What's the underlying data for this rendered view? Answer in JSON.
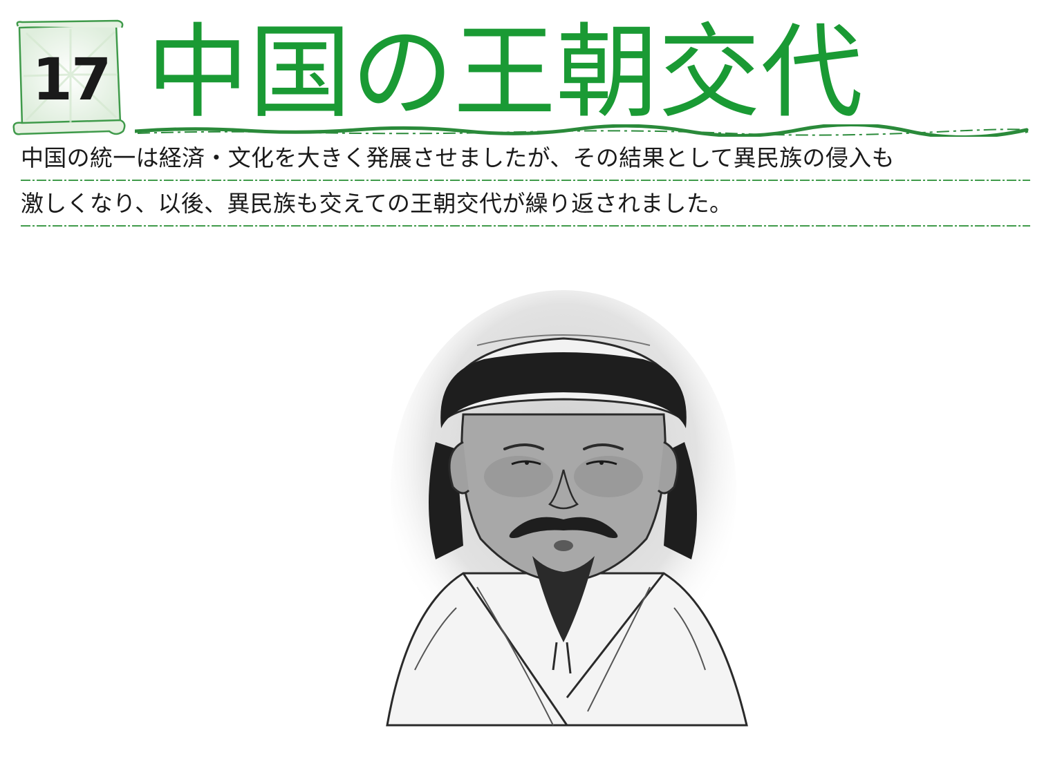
{
  "chapter": {
    "number": "17",
    "title": "中国の王朝交代"
  },
  "intro": {
    "line1": "中国の統一は経済・文化を大きく発展させましたが、その結果として異民族の侵入も",
    "line2": "激しくなり、以後、異民族も交えての王朝交代が繰り返されました。"
  },
  "colors": {
    "accent": "#1a9a34",
    "scroll_fill": "#f2f8ee",
    "scroll_stroke": "#3f9a4a",
    "text": "#1a1a1a"
  }
}
